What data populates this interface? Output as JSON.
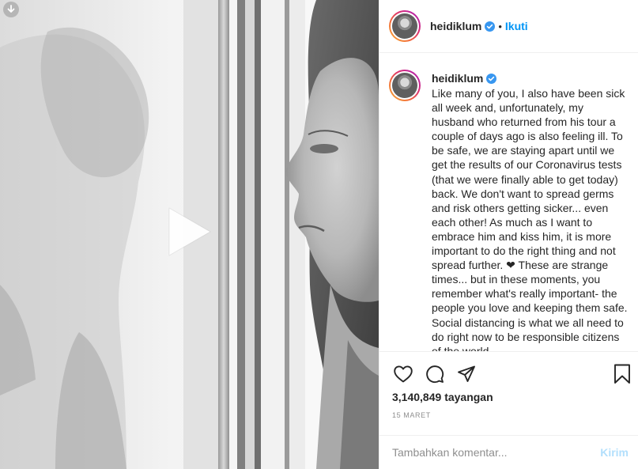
{
  "header": {
    "username": "heidiklum",
    "separator": "•",
    "follow_label": "Ikuti"
  },
  "caption": {
    "username": "heidiklum",
    "text": "Like many of you, I also have been sick all week and, unfortunately, my husband who returned from his tour a couple of days ago is also feeling ill. To be safe, we are staying apart until we get the results of our Coronavirus tests (that we were finally able to get today) back. We don't want to spread germs and risk others getting sicker... even each other! As much as I want to embrace him and kiss him, it is more important to do the right thing and not spread further. ❤ These are strange times... but in these moments, you remember what's really important- the people you love and keeping them safe. Social distancing is what we all need to do right now to be responsible citizens of the world."
  },
  "stats": {
    "views_count": "3,140,849",
    "views_label": "tayangan",
    "date": "15 MARET"
  },
  "comment": {
    "placeholder": "Tambahkan komentar...",
    "post_label": "Kirim"
  },
  "colors": {
    "accent": "#0095f6",
    "post_disabled": "#b2dffc",
    "verified": "#3897f0"
  },
  "icons": {
    "download": "download-icon",
    "play": "play-icon",
    "like": "heart-icon",
    "comment": "comment-icon",
    "share": "paper-plane-icon",
    "save": "bookmark-icon",
    "verified": "verified-badge-icon"
  }
}
